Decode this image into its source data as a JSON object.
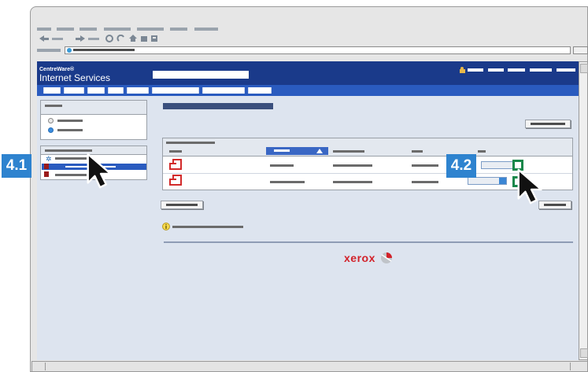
{
  "app": {
    "brand_line1": "CentreWare®",
    "brand_line2": "Internet Services",
    "footer_logo": "xerox"
  },
  "callouts": {
    "step1": "4.1",
    "step2": "4.2"
  },
  "icons": {
    "back": "back-arrow-icon",
    "forward": "forward-arrow-icon",
    "stop": "stop-icon",
    "refresh": "refresh-icon",
    "home": "home-icon",
    "bookmarks": "bookmark-icon",
    "print": "print-icon",
    "user": "user-lock-icon",
    "info": "info-icon",
    "document": "document-icon",
    "print_job": "print-job-icon"
  },
  "colors": {
    "header": "#1a3a8a",
    "nav": "#2a5bbf",
    "content": "#dde4ef",
    "callout": "#2e83cf",
    "doc_icon": "#d22a2a",
    "action_icon": "#17874a",
    "xerox_red": "#d2222a"
  }
}
